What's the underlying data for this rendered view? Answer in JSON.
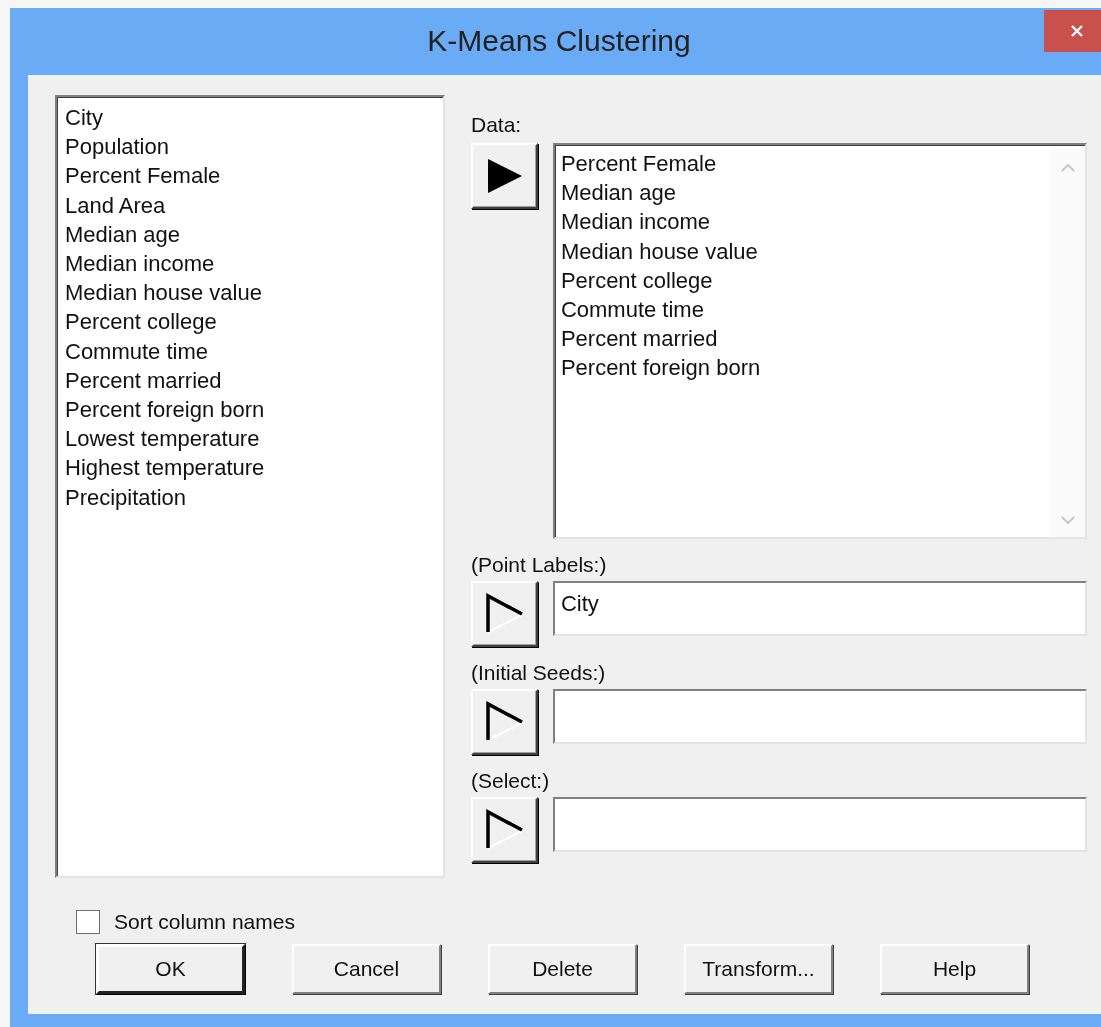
{
  "window": {
    "title": "K-Means Clustering"
  },
  "columns": [
    "City",
    "Population",
    "Percent Female",
    "Land Area",
    "Median age",
    "Median income",
    "Median house value",
    "Percent college",
    "Commute time",
    "Percent married",
    "Percent foreign born",
    "Lowest temperature",
    "Highest temperature",
    "Precipitation"
  ],
  "data": {
    "label": "Data:",
    "kind": "filled",
    "items": [
      "Percent Female",
      "Median age",
      "Median income",
      "Median house value",
      "Percent college",
      "Commute time",
      "Percent married",
      "Percent foreign born"
    ]
  },
  "targets": [
    {
      "label": "(Point Labels:)",
      "kind": "hollow",
      "value": "City"
    },
    {
      "label": "(Initial Seeds:)",
      "kind": "hollow"
    },
    {
      "label": "(Select:)",
      "kind": "hollow"
    }
  ],
  "sort": {
    "label": "Sort column names",
    "checked": false
  },
  "buttons": [
    {
      "label": "OK",
      "default": true
    },
    {
      "label": "Cancel",
      "default": false
    },
    {
      "label": "Delete",
      "default": false
    },
    {
      "label": "Transform...",
      "default": false
    },
    {
      "label": "Help",
      "default": false
    }
  ]
}
